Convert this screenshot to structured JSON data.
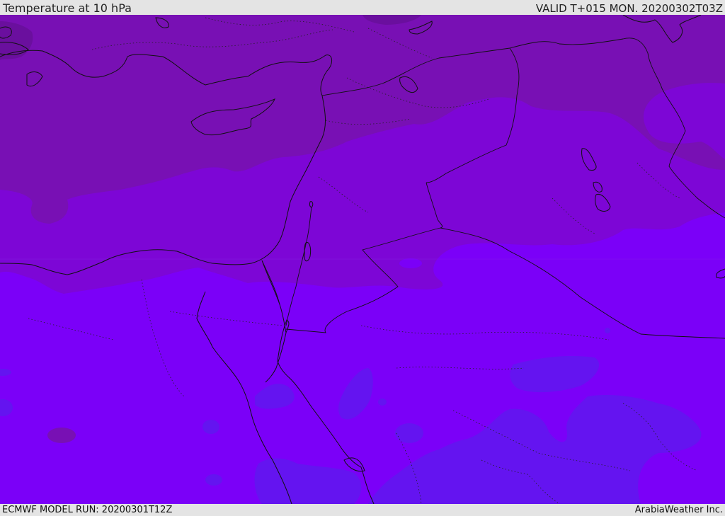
{
  "header": {
    "title": "Temperature at 10 hPa",
    "valid": "VALID T+015 MON. 20200302T03Z"
  },
  "footer": {
    "model_run": "ECMWF MODEL RUN: 20200301T12Z",
    "credit": "ArabiaWeather Inc."
  },
  "colors": {
    "band_coldest": "#6a0f9e",
    "band_1": "#7810b4",
    "band_2": "#7d06d6",
    "band_3": "#7b00f8",
    "band_warmest": "#6414f0",
    "coast_line": "#111111",
    "background": "#e4e4e4"
  }
}
